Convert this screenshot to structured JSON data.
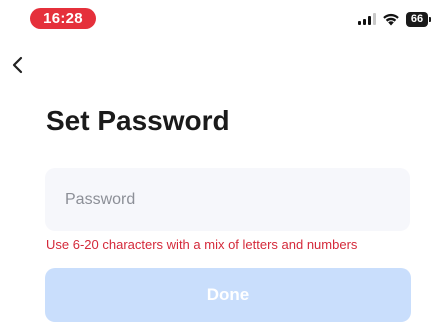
{
  "status_bar": {
    "time": "16:28",
    "time_pill_color": "#e5303b",
    "signal_icon": "cellular-signal-icon",
    "wifi_icon": "wifi-icon",
    "battery_level": "66",
    "battery_icon": "battery-icon"
  },
  "nav": {
    "back_icon": "chevron-left-icon"
  },
  "page": {
    "title": "Set Password"
  },
  "form": {
    "password": {
      "placeholder": "Password",
      "value": "",
      "type": "password"
    },
    "hint": "Use 6-20 characters with a mix of letters and numbers",
    "hint_color": "#d4293a",
    "submit": {
      "label": "Done",
      "state": "disabled",
      "color": "#c9defc"
    }
  }
}
